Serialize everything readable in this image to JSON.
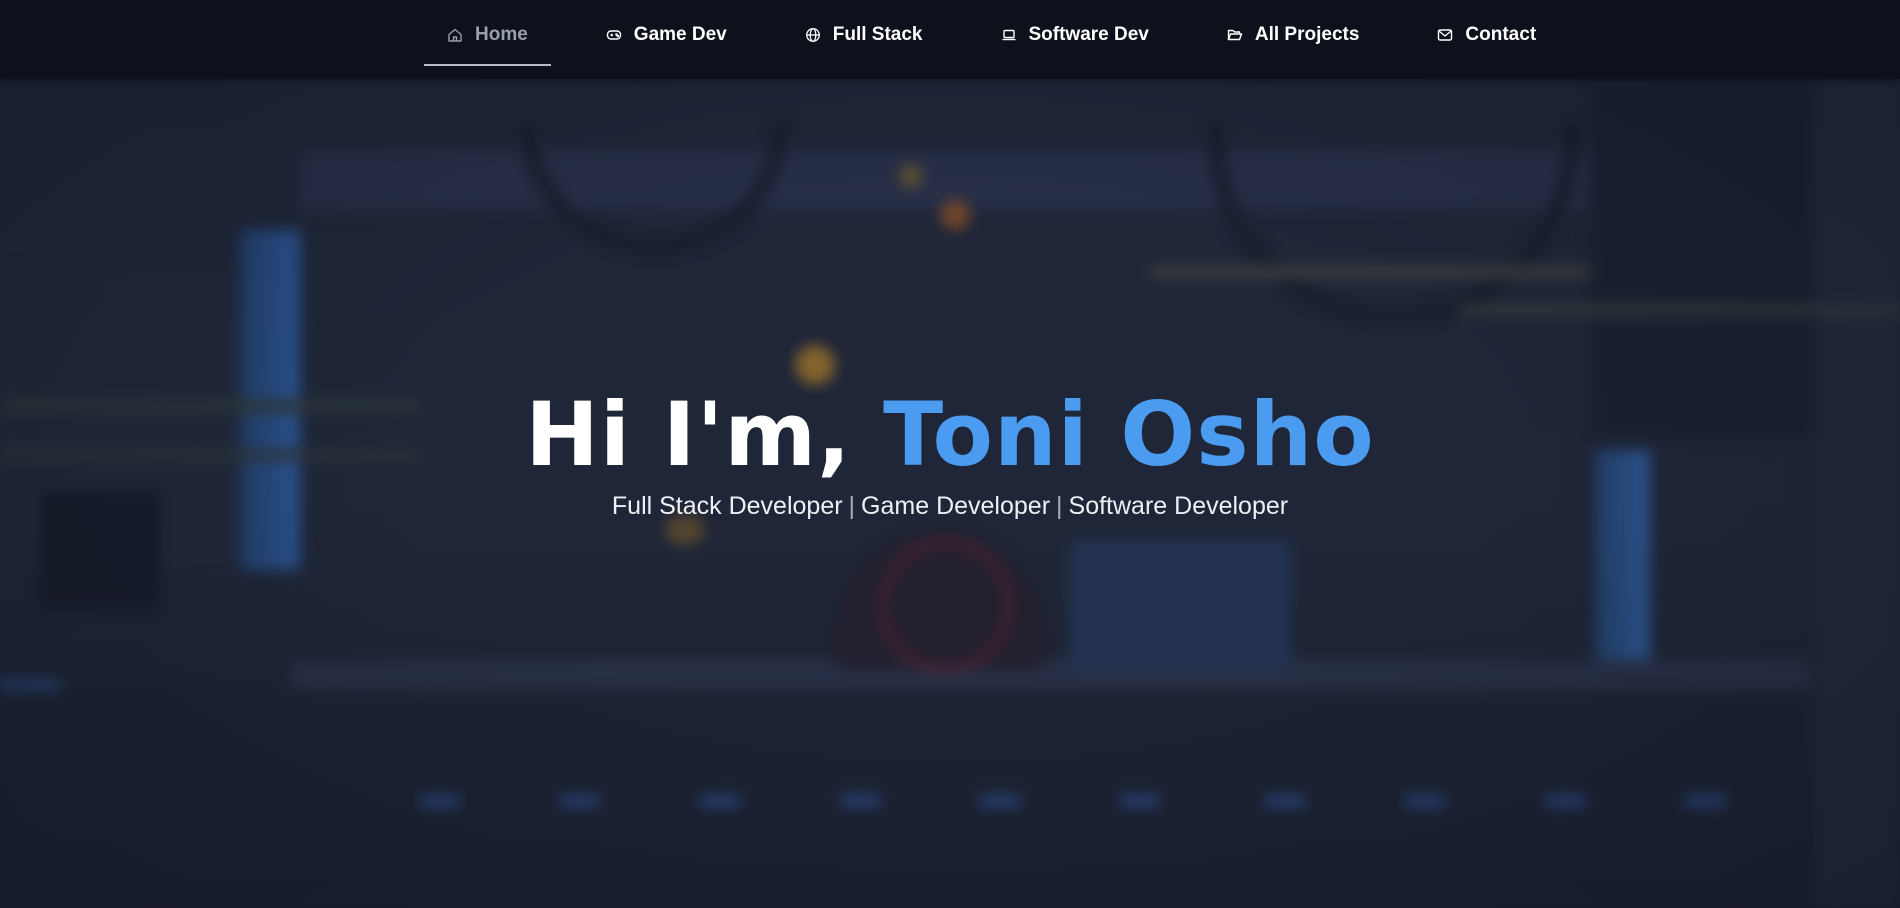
{
  "nav": {
    "items": [
      {
        "label": "Home",
        "icon": "home-icon",
        "active": true
      },
      {
        "label": "Game Dev",
        "icon": "gamepad-icon",
        "active": false
      },
      {
        "label": "Full Stack",
        "icon": "globe-icon",
        "active": false
      },
      {
        "label": "Software Dev",
        "icon": "laptop-icon",
        "active": false
      },
      {
        "label": "All Projects",
        "icon": "folder-open-icon",
        "active": false
      },
      {
        "label": "Contact",
        "icon": "mail-icon",
        "active": false
      }
    ]
  },
  "hero": {
    "greeting": "Hi I'm, ",
    "name": "Toni Osho",
    "roles": [
      "Full Stack Developer",
      "Game Developer",
      "Software Developer"
    ],
    "separator": "|"
  },
  "colors": {
    "accent": "#4b9cf0",
    "nav_background": "#0d111b",
    "page_background": "#1e2538",
    "active_nav_text": "#9aa0ab"
  }
}
